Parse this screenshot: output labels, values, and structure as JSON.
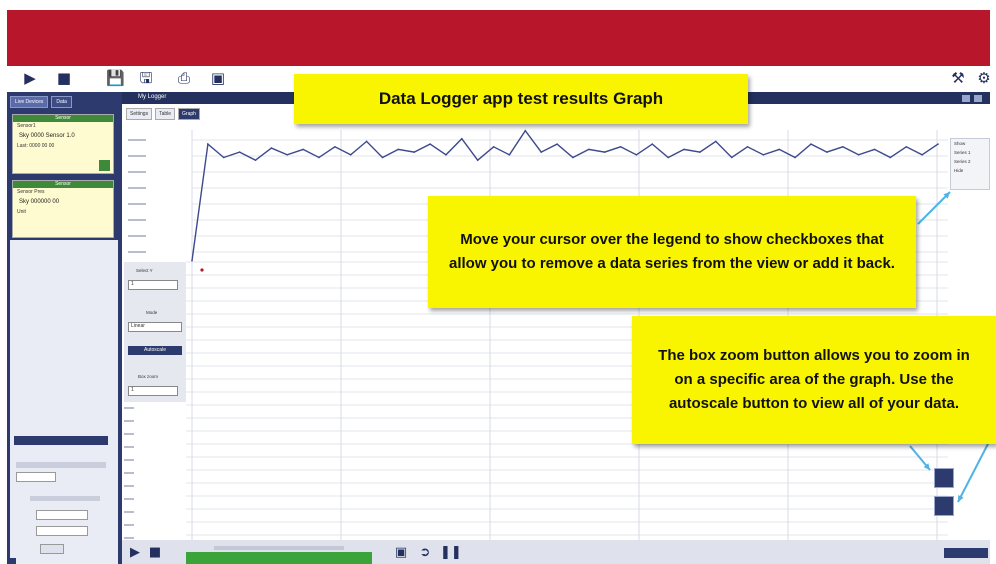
{
  "title_callout": "Data Logger app test results Graph",
  "legend_callout": "Move your cursor over the legend to show checkboxes that allow you to remove a data series from the view or add it back.",
  "zoom_callout": "The box zoom button allows you to zoom in on a specific area of the graph. Use the autoscale button to view all of your data.",
  "colors": {
    "banner": "#b8162a",
    "navy": "#24305e",
    "callout": "#f9f500",
    "series": "#3d4a8c",
    "progress": "#3aa33a"
  },
  "toolbar": {
    "icons": [
      "play-icon",
      "stop-icon",
      "save-icon",
      "save-as-icon",
      "print-icon",
      "camera-icon",
      "wrench-icon",
      "gear-icon"
    ]
  },
  "left_panel": {
    "tabs": [
      "Live Devices",
      "Data"
    ],
    "device1_head": "Sensor",
    "device1_name": "Sensor1",
    "device1_value": "Sky 0000 Sensor 1.0",
    "device1_label": "Last: 0000 00 00",
    "device2_head": "Sensor",
    "device2_name": "Sensor Pres",
    "device2_value": "Sky 000000 00",
    "device2_unit": "Unit"
  },
  "main": {
    "window_title": "My Logger",
    "tabs": [
      "Settings",
      "Table",
      "Graph"
    ],
    "control_labels": [
      "Select Y",
      "Mode",
      "Autoscale",
      "Box zoom"
    ],
    "select_values": [
      "1",
      "Linear",
      "1"
    ]
  },
  "legend": {
    "items": [
      "Show",
      "Series 1",
      "Series 2",
      "Hide"
    ]
  },
  "chart_data": {
    "type": "line",
    "series": [
      {
        "values": [
          1,
          88,
          78,
          82,
          76,
          85,
          80,
          84,
          78,
          86,
          80,
          90,
          78,
          84,
          82,
          88,
          80,
          92,
          76,
          86,
          80,
          98,
          82,
          88,
          78,
          84,
          82,
          86,
          80,
          88,
          78,
          84,
          82,
          90,
          78,
          86,
          80,
          84,
          78,
          88,
          82,
          86,
          80,
          84,
          78,
          86,
          80,
          88
        ]
      }
    ],
    "grid": true
  }
}
